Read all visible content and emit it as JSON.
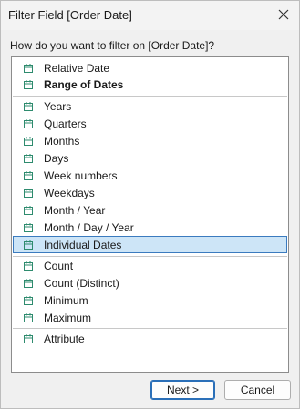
{
  "window": {
    "title": "Filter Field [Order Date]"
  },
  "prompt": "How do you want to filter on [Order Date]?",
  "list": {
    "items": [
      {
        "label": "Relative Date",
        "icon": "calendar-icon",
        "bold": false,
        "selected": false
      },
      {
        "label": "Range of Dates",
        "icon": "calendar-icon",
        "bold": true,
        "selected": false
      },
      {
        "label": "Years",
        "icon": "calendar-icon",
        "bold": false,
        "selected": false
      },
      {
        "label": "Quarters",
        "icon": "calendar-icon",
        "bold": false,
        "selected": false
      },
      {
        "label": "Months",
        "icon": "calendar-icon",
        "bold": false,
        "selected": false
      },
      {
        "label": "Days",
        "icon": "calendar-icon",
        "bold": false,
        "selected": false
      },
      {
        "label": "Week numbers",
        "icon": "calendar-icon",
        "bold": false,
        "selected": false
      },
      {
        "label": "Weekdays",
        "icon": "calendar-icon",
        "bold": false,
        "selected": false
      },
      {
        "label": "Month / Year",
        "icon": "calendar-icon",
        "bold": false,
        "selected": false
      },
      {
        "label": "Month / Day / Year",
        "icon": "calendar-icon",
        "bold": false,
        "selected": false
      },
      {
        "label": "Individual Dates",
        "icon": "calendar-icon",
        "bold": false,
        "selected": true
      },
      {
        "label": "Count",
        "icon": "calendar-icon",
        "bold": false,
        "selected": false
      },
      {
        "label": "Count (Distinct)",
        "icon": "calendar-icon",
        "bold": false,
        "selected": false
      },
      {
        "label": "Minimum",
        "icon": "calendar-icon",
        "bold": false,
        "selected": false
      },
      {
        "label": "Maximum",
        "icon": "calendar-icon",
        "bold": false,
        "selected": false
      },
      {
        "label": "Attribute",
        "icon": "calendar-icon",
        "bold": false,
        "selected": false
      }
    ]
  },
  "buttons": {
    "next_label": "Next >",
    "cancel_label": "Cancel"
  },
  "colors": {
    "icon": "#2e8b6e",
    "selection_fill": "#cde5f7",
    "selection_border": "#3b7bbf"
  }
}
